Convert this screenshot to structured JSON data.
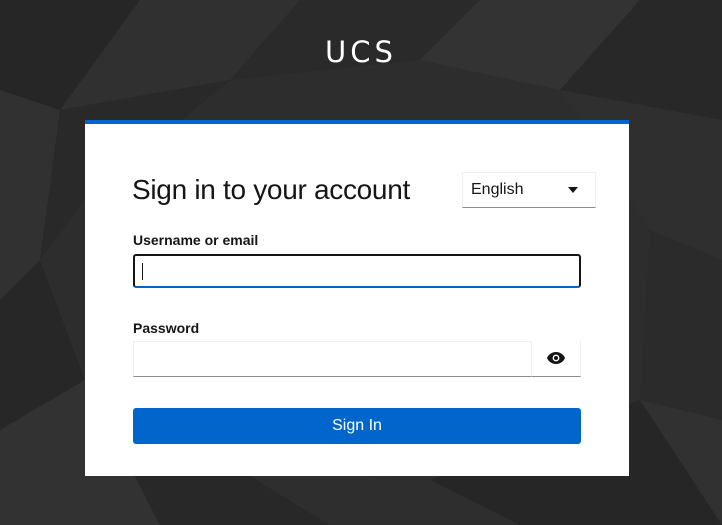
{
  "brand": {
    "logo_text": "UCS"
  },
  "login": {
    "title": "Sign in to your account",
    "language": {
      "selected": "English"
    },
    "username": {
      "label": "Username or email",
      "value": ""
    },
    "password": {
      "label": "Password",
      "value": "",
      "toggle_icon": "eye-icon"
    },
    "submit_label": "Sign In"
  },
  "colors": {
    "accent": "#0066cc",
    "background": "#2b2b2b",
    "card": "#ffffff",
    "text": "#151515"
  }
}
